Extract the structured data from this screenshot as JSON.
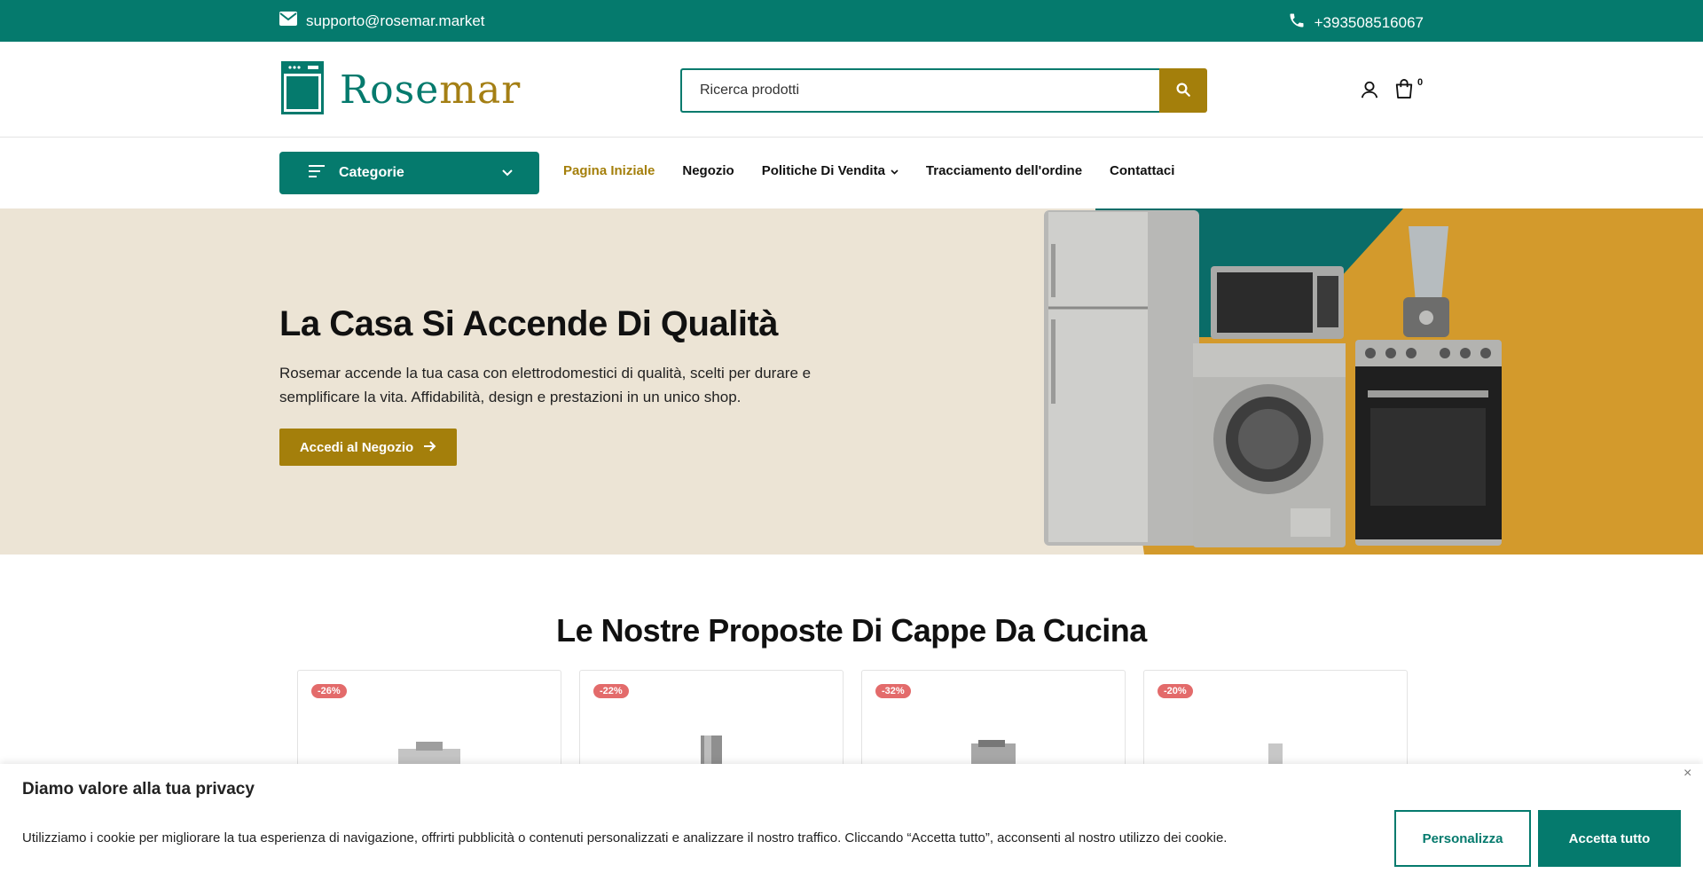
{
  "topbar": {
    "email": "supporto@rosemar.market",
    "phone": "+393508516067",
    "icons": [
      "envelope-icon",
      "phone-icon"
    ]
  },
  "header": {
    "logo_text_main": "Rose",
    "logo_text_accent": "mar",
    "search_placeholder": "Ricerca prodotti",
    "cart_count": "0",
    "icons": [
      "search-icon",
      "user-icon",
      "cart-icon"
    ]
  },
  "nav": {
    "categories_label": "Categorie",
    "links": [
      {
        "label": "Pagina Iniziale",
        "active": true
      },
      {
        "label": "Negozio"
      },
      {
        "label": "Politiche Di Vendita",
        "dropdown": true
      },
      {
        "label": "Tracciamento dell'ordine"
      },
      {
        "label": "Contattaci"
      }
    ]
  },
  "hero": {
    "title": "La Casa Si Accende Di Qualità",
    "text": "Rosemar accende la tua casa con elettrodomestici di qualità, scelti per durare e semplificare la vita. Affidabilità, design e prestazioni in un unico shop.",
    "button_label": "Accedi al Negozio"
  },
  "section": {
    "title": "Le Nostre Proposte Di Cappe Da Cucina",
    "products": [
      {
        "discount": "-26%"
      },
      {
        "discount": "-22%"
      },
      {
        "discount": "-32%"
      },
      {
        "discount": "-20%"
      }
    ]
  },
  "cookie": {
    "title": "Diamo valore alla tua privacy",
    "text": "Utilizziamo i cookie per migliorare la tua esperienza di navigazione, offrirti pubblicità o contenuti personalizzati e analizzare il nostro traffico. Cliccando “Accetta tutto”, acconsenti al nostro utilizzo dei cookie.",
    "customize_label": "Personalizza",
    "accept_label": "Accetta tutto",
    "close_label": "×"
  },
  "colors": {
    "brand_green": "#057a6d",
    "brand_gold": "#a47f0b",
    "hero_bg": "#ece4d5",
    "badge_red": "#e36b6b"
  }
}
